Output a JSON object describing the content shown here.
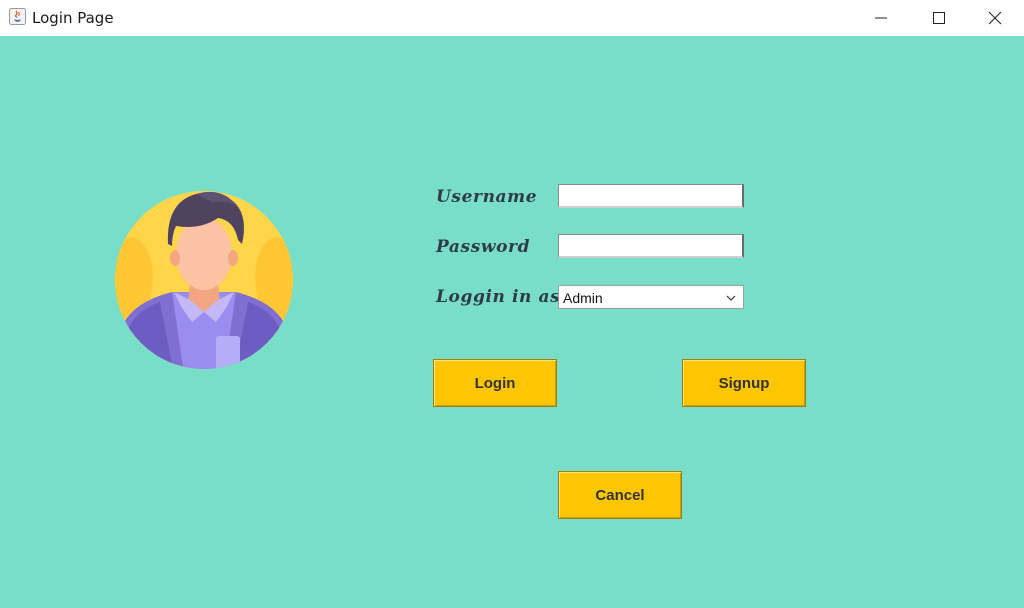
{
  "window": {
    "title": "Login Page",
    "icons": {
      "app": "java-app-icon",
      "minimize": "minimize-icon",
      "maximize": "maximize-icon",
      "close": "close-icon"
    }
  },
  "colors": {
    "background": "#78dec8",
    "button": "#fec601",
    "label": "#2e3b48",
    "avatar_circle": "#ffd64a"
  },
  "avatar": {
    "icon": "user-avatar-icon"
  },
  "form": {
    "username_label": "Username",
    "username_value": "",
    "password_label": "Password",
    "password_value": "",
    "role_label": "Loggin in as",
    "role_selected": "Admin",
    "role_icon": "chevron-down-icon"
  },
  "buttons": {
    "login": "Login",
    "signup": "Signup",
    "cancel": "Cancel"
  }
}
